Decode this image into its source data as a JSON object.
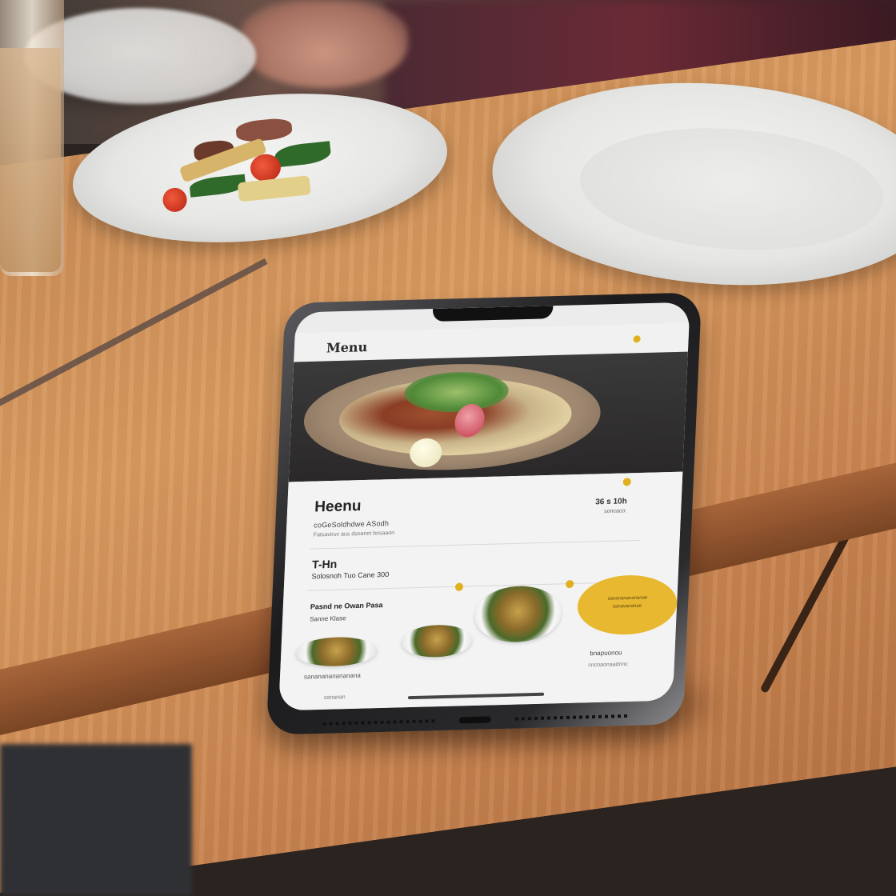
{
  "image": {
    "description_role": "photo of a smartphone on a wooden restaurant table showing a menu app"
  },
  "phone_app": {
    "status": {
      "time": "",
      "icons": ""
    },
    "header": {
      "title": "Menu"
    },
    "dish": {
      "title": "Heenu",
      "description": "coGeSoldhdwe ASodh",
      "description2": "Fatsaviruv aus dsoanet bosaaon",
      "price": "36 s 10h",
      "price_note": "soncaco:"
    },
    "section2": {
      "title": "T-Hn",
      "subtitle": "Solosnoh Tuo Cane 300"
    },
    "section3": {
      "title": "Pasnd ne Owan Pasa",
      "subtitle": "Sanne Klase"
    },
    "promo": {
      "line1": "sananananananae",
      "line2": "sanavananae"
    },
    "bottom": {
      "left": "sananananananana",
      "left2": "sananan",
      "right": "bnapuonou",
      "right2": "cncoaonaadnnc"
    }
  },
  "colors": {
    "accent": "#e0b020",
    "screen_bg": "#f3f3f3",
    "table": "#d99a5f"
  },
  "icons": [
    "notch",
    "status-dot",
    "promo-badge"
  ]
}
